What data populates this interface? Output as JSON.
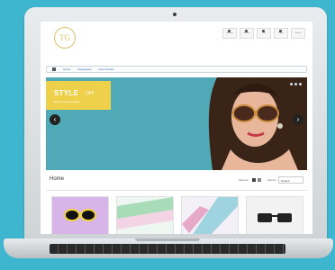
{
  "site": {
    "logo_text": "TG",
    "top_links": [
      "Account",
      "Wishlist",
      "Cart",
      "Login",
      "Search"
    ],
    "nav": {
      "items": [
        "Home",
        "Sunglasses",
        "New Arrivals"
      ]
    },
    "hero": {
      "promo_title": "STYLE",
      "promo_off": "OFF",
      "promo_sub": "Summer sale on eyewear",
      "prev_label": "‹",
      "next_label": "›"
    },
    "toolbar": {
      "page_title": "Home",
      "view_as_label": "View as",
      "sort_by_label": "Sort by",
      "sort_value": "Default"
    },
    "products": [
      {
        "icon": "sunglasses-product"
      },
      {
        "icon": "pastel-product"
      },
      {
        "icon": "pastel-product"
      },
      {
        "icon": "sunglasses-product"
      }
    ]
  },
  "colors": {
    "background": "#3fb6d0",
    "hero_bg": "#4fa9b6",
    "promo_yellow": "#efd04a",
    "logo_gold": "#e0c26a",
    "nav_link": "#2f6db5"
  }
}
